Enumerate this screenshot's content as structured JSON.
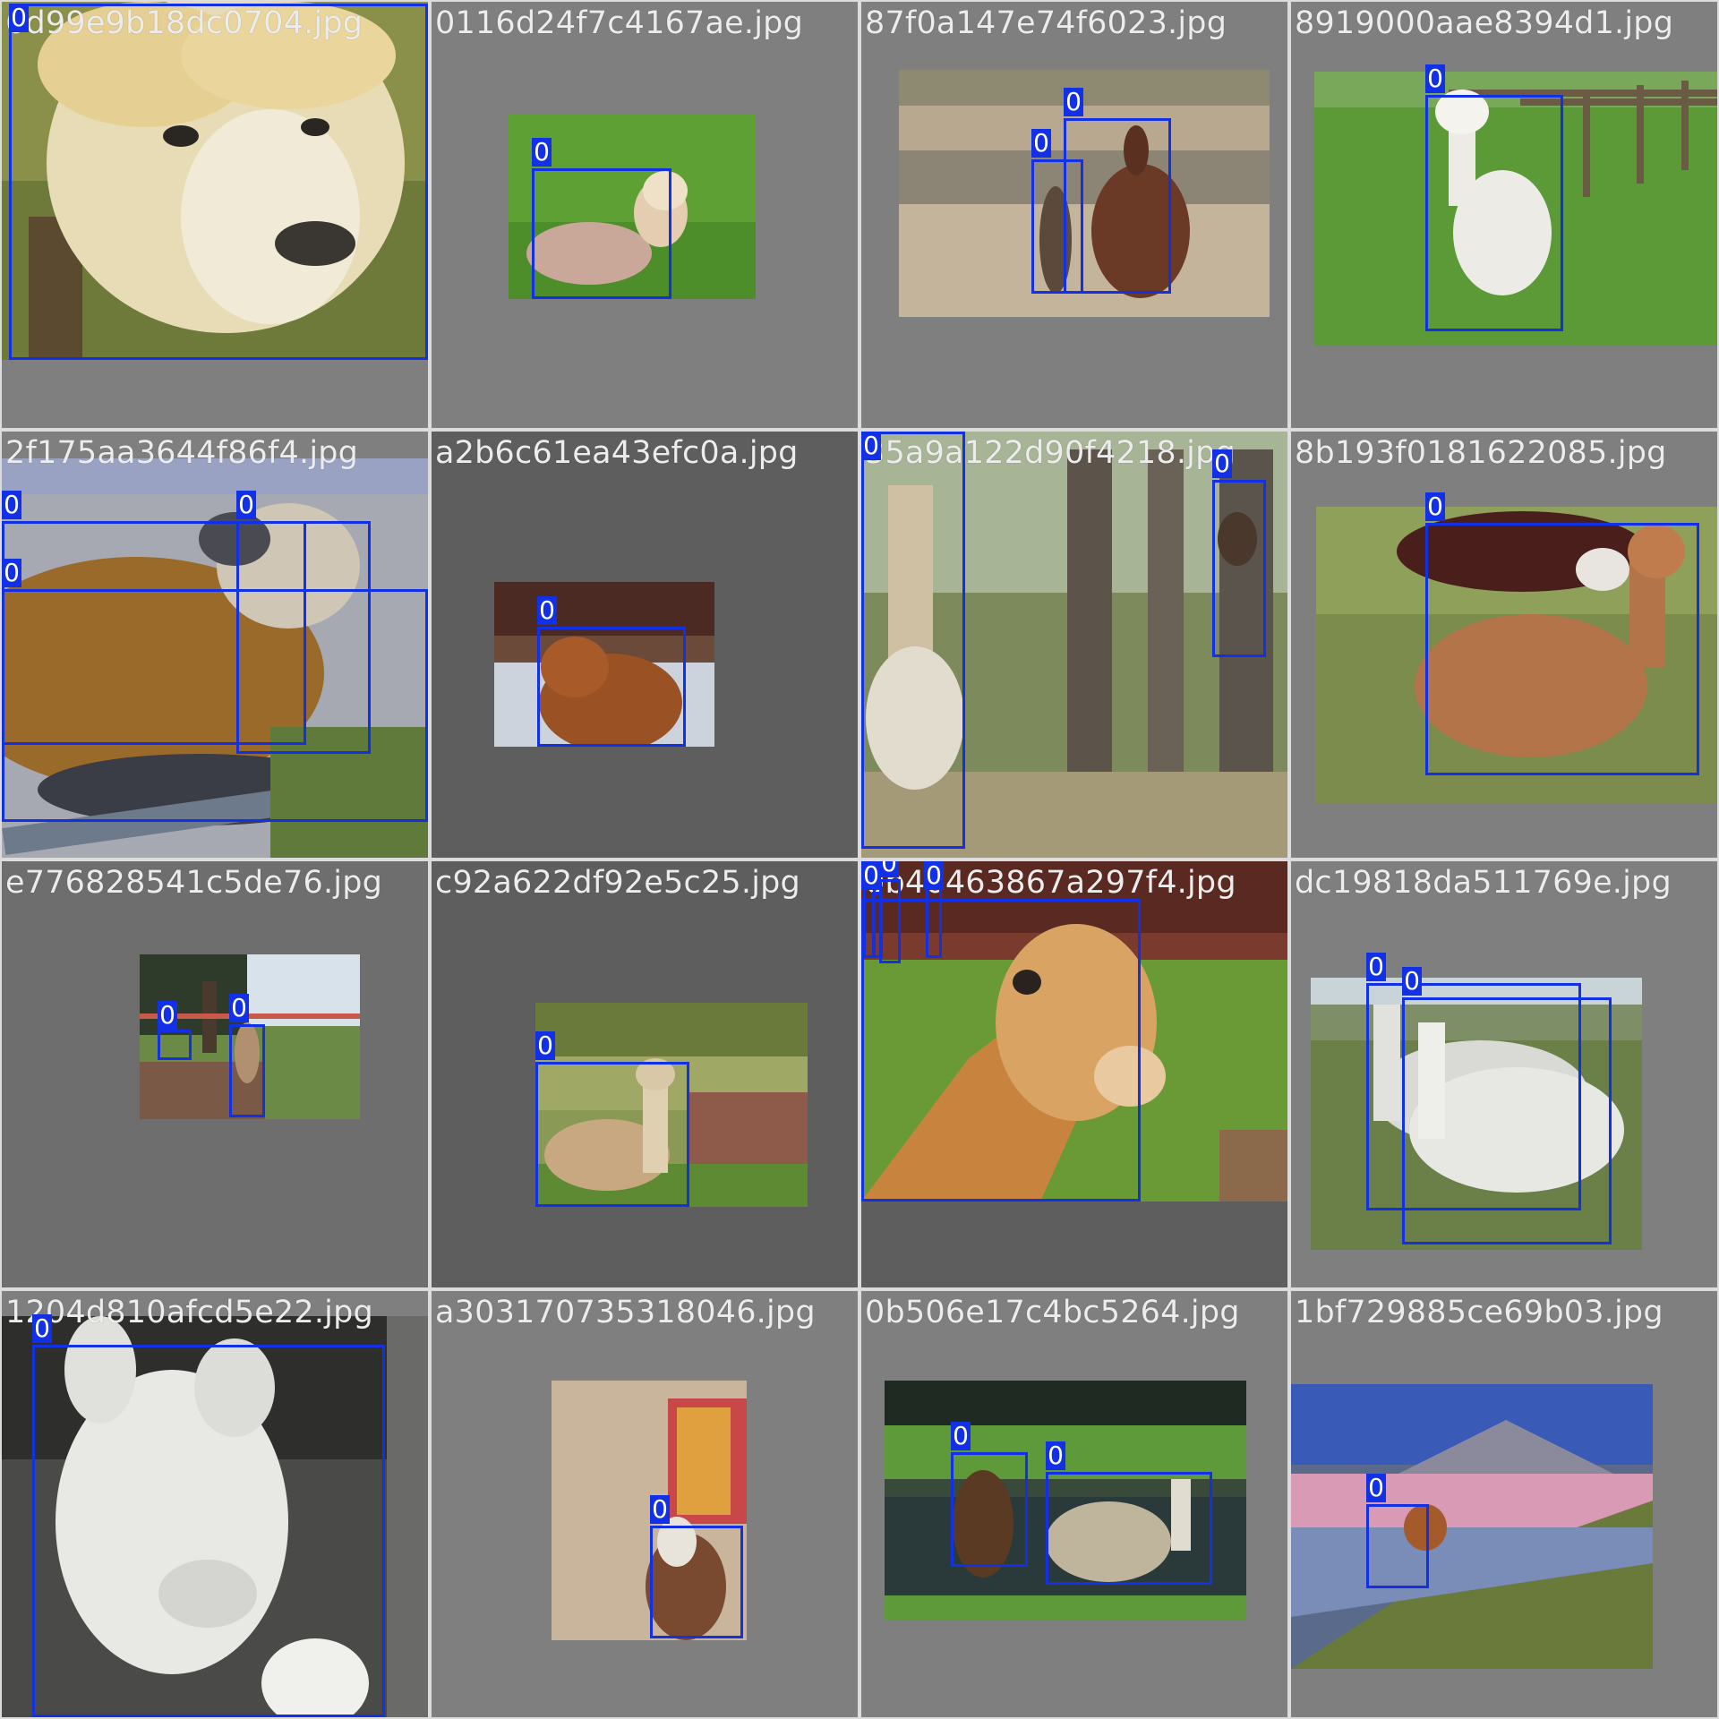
{
  "colors": {
    "box": "#1230e6",
    "label_bg": "#1230e6",
    "label_text": "#ffffff",
    "filename_text": "#ececec",
    "tile_bg": "#7f7f7f"
  },
  "box_label": "0",
  "tiles": [
    {
      "filename": "6d99e9b18dc0704.jpg",
      "boxes": 1
    },
    {
      "filename": "0116d24f7c4167ae.jpg",
      "boxes": 1
    },
    {
      "filename": "87f0a147e74f6023.jpg",
      "boxes": 2
    },
    {
      "filename": "8919000aae8394d1.jpg",
      "boxes": 1
    },
    {
      "filename": "2f175aa3644f86f4.jpg",
      "boxes": 3
    },
    {
      "filename": "a2b6c61ea43efc0a.jpg",
      "boxes": 1
    },
    {
      "filename": "35a9a122d90f4218.jpg",
      "boxes": 2
    },
    {
      "filename": "8b193f0181622085.jpg",
      "boxes": 1
    },
    {
      "filename": "e776828541c5de76.jpg",
      "boxes": 2
    },
    {
      "filename": "c92a622df92e5c25.jpg",
      "boxes": 1
    },
    {
      "filename": "0b40463867a297f4.jpg",
      "boxes": 5
    },
    {
      "filename": "dc19818da511769e.jpg",
      "boxes": 2
    },
    {
      "filename": "1204d810afcd5e22.jpg",
      "boxes": 1
    },
    {
      "filename": "a303170735318046.jpg",
      "boxes": 1
    },
    {
      "filename": "0b506e17c4bc5264.jpg",
      "boxes": 2
    },
    {
      "filename": "1bf729885ce69b03.jpg",
      "boxes": 1
    }
  ]
}
